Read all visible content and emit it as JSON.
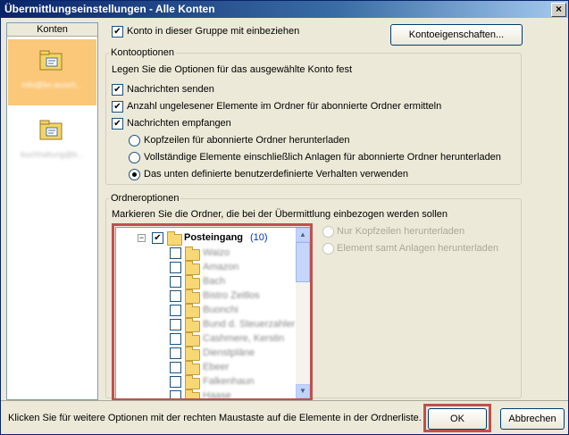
{
  "window": {
    "title": "Übermittlungseinstellungen - Alle Konten",
    "close": "×"
  },
  "sidebar": {
    "header": "Konten",
    "accounts": [
      {
        "name": "info@bn-ausch...",
        "selected": true
      },
      {
        "name": "buchhaltung@b...",
        "selected": false
      }
    ]
  },
  "include_group": {
    "label": "Konto in dieser Gruppe mit einbeziehen",
    "checked": true
  },
  "account_properties_button": "Kontoeigenschaften...",
  "account_options": {
    "title": "Kontooptionen",
    "description": "Legen Sie die Optionen für das ausgewählte Konto fest",
    "send": {
      "label": "Nachrichten senden",
      "checked": true
    },
    "unread_count": {
      "label": "Anzahl ungelesener Elemente im Ordner für abonnierte Ordner ermitteln",
      "checked": true
    },
    "receive": {
      "label": "Nachrichten empfangen",
      "checked": true
    },
    "radios": [
      {
        "label": "Kopfzeilen für abonnierte Ordner herunterladen",
        "selected": false
      },
      {
        "label": "Vollständige Elemente einschließlich Anlagen für abonnierte Ordner herunterladen",
        "selected": false
      },
      {
        "label": "Das unten definierte benutzerdefinierte Verhalten verwenden",
        "selected": true
      }
    ]
  },
  "folder_options": {
    "title": "Ordneroptionen",
    "description": "Markieren Sie die Ordner, die bei der Übermittlung einbezogen werden sollen",
    "inbox": {
      "name": "Posteingang",
      "count": "(10)",
      "checked": true
    },
    "subfolders": [
      "Waizo",
      "Amazon",
      "Bach",
      "Bistro Zeitlos",
      "Buonchi",
      "Bund d. Steuerzahler",
      "Cashmere, Kerstin",
      "Dienstpläne",
      "Ebeer",
      "Falkenhaun",
      "Haase"
    ],
    "download_radios": [
      {
        "label": "Nur Kopfzeilen herunterladen",
        "enabled": false
      },
      {
        "label": "Element samt Anlagen herunterladen",
        "enabled": false
      }
    ]
  },
  "status_text": "Klicken Sie für weitere Optionen mit der rechten Maustaste auf die Elemente in der Ordnerliste.",
  "buttons": {
    "ok": "OK",
    "cancel": "Abbrechen"
  }
}
